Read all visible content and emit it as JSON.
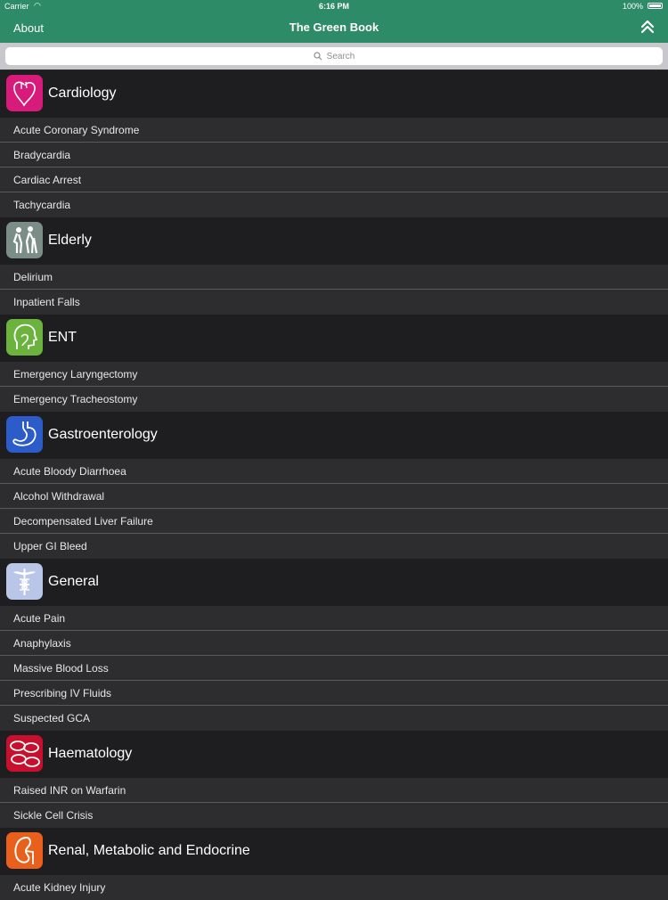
{
  "status_bar": {
    "carrier": "Carrier",
    "time": "6:16 PM",
    "battery": "100%"
  },
  "nav": {
    "about": "About",
    "title": "The Green Book",
    "collapse_icon": "double-chevron-up-icon"
  },
  "search": {
    "placeholder": "Search"
  },
  "colors": {
    "nav_green": "#2e8b67",
    "header_bg": "#1e1e20",
    "row_bg": "#2d2d2f",
    "cardiology": "#d81b7a",
    "elderly": "#7a8e87",
    "ent": "#6cb33e",
    "gastro": "#2b5cc9",
    "general": "#b9c6e8",
    "haematology": "#c8102e",
    "renal": "#e8601c"
  },
  "sections": [
    {
      "title": "Cardiology",
      "icon": "heart-icon",
      "items": [
        "Acute Coronary Syndrome",
        "Bradycardia",
        "Cardiac Arrest",
        "Tachycardia"
      ]
    },
    {
      "title": "Elderly",
      "icon": "elderly-couple-icon",
      "items": [
        "Delirium",
        "Inpatient Falls"
      ]
    },
    {
      "title": "ENT",
      "icon": "head-profile-icon",
      "items": [
        "Emergency Laryngectomy",
        "Emergency Tracheostomy"
      ]
    },
    {
      "title": "Gastroenterology",
      "icon": "stomach-icon",
      "items": [
        "Acute Bloody Diarrhoea",
        "Alcohol Withdrawal",
        "Decompensated Liver Failure",
        "Upper GI Bleed"
      ]
    },
    {
      "title": "General",
      "icon": "caduceus-icon",
      "items": [
        "Acute Pain",
        "Anaphylaxis",
        "Massive Blood Loss",
        "Prescribing IV Fluids",
        "Suspected GCA"
      ]
    },
    {
      "title": "Haematology",
      "icon": "blood-cells-icon",
      "items": [
        "Raised INR on Warfarin",
        "Sickle Cell Crisis"
      ]
    },
    {
      "title": "Renal, Metabolic and Endocrine",
      "icon": "kidney-icon",
      "items": [
        "Acute Kidney Injury"
      ]
    }
  ]
}
